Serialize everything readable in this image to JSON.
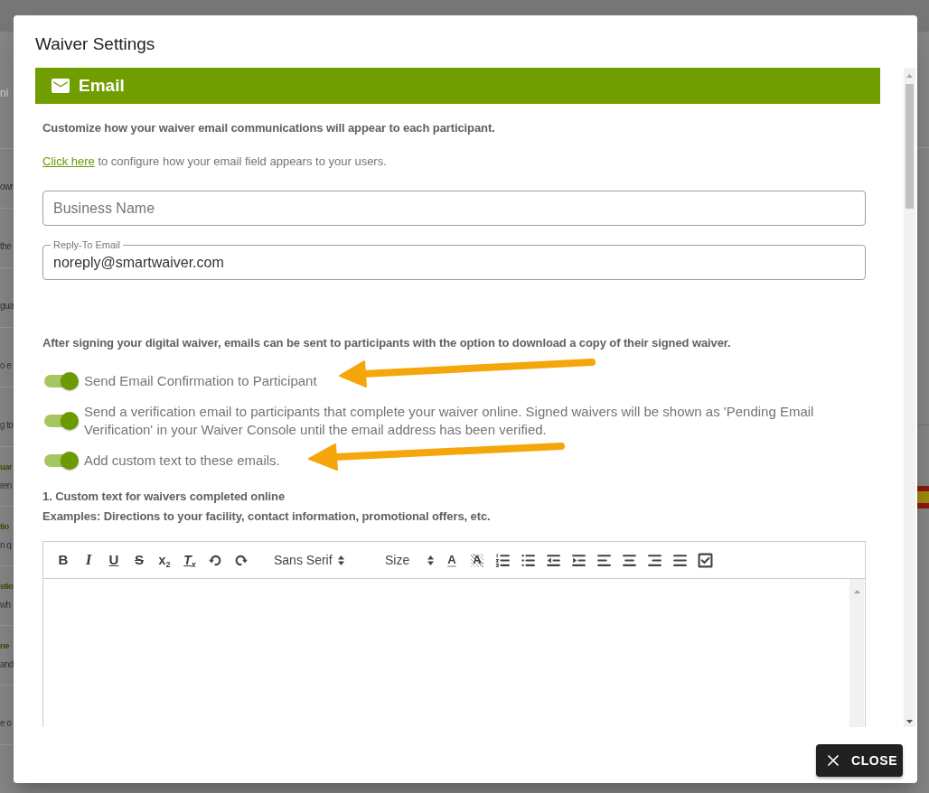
{
  "background_page": {
    "field_hint": "ni",
    "rows": [
      {
        "lines": [
          {
            "kind": "body",
            "text": "own"
          }
        ]
      },
      {
        "lines": [
          {
            "kind": "body",
            "text": "the"
          }
        ]
      },
      {
        "lines": [
          {
            "kind": "body",
            "text": "gua"
          }
        ]
      },
      {
        "lines": [
          {
            "kind": "body",
            "text": "o e"
          }
        ]
      },
      {
        "lines": [
          {
            "kind": "body",
            "text": "g to"
          }
        ]
      },
      {
        "lines": [
          {
            "kind": "heading",
            "text": "uar"
          },
          {
            "kind": "body",
            "text": "ren"
          }
        ]
      },
      {
        "lines": [
          {
            "kind": "heading",
            "text": "tio"
          },
          {
            "kind": "body",
            "text": "n q"
          }
        ]
      },
      {
        "lines": [
          {
            "kind": "heading",
            "text": "stio"
          },
          {
            "kind": "body",
            "text": "wh"
          }
        ]
      },
      {
        "lines": [
          {
            "kind": "heading",
            "text": "ne"
          },
          {
            "kind": "body",
            "text": "and"
          }
        ]
      },
      {
        "lines": [
          {
            "kind": "body",
            "text": "e o"
          }
        ]
      }
    ]
  },
  "dialog": {
    "title": "Waiver Settings",
    "section": {
      "title": "Email"
    },
    "intro": "Customize how your waiver email communications will appear to each participant.",
    "config_line": {
      "link": "Click here",
      "text": "to configure how your email field appears to your users."
    },
    "fields": [
      {
        "kind": "text",
        "placeholder": "Business Name"
      },
      {
        "kind": "text",
        "label": "Reply-To Email",
        "value": "noreply@smartwaiver.com"
      }
    ],
    "notice": "After signing your digital waiver, emails can be sent to participants with the option to download a copy of their signed waiver.",
    "toggles": [
      {
        "label": "Send Email Confirmation to Participant",
        "on": true
      },
      {
        "label": "Send a verification email to participants that complete your waiver online. Signed waivers will be shown as 'Pending Email Verification' in your Waiver Console until the email address has been verified.",
        "on": true
      },
      {
        "label": "Add custom text to these emails.",
        "on": true
      }
    ],
    "custom_text": {
      "heading": "1. Custom text for waivers completed online",
      "examples": "Examples: Directions to your facility, contact information, promotional offers, etc.",
      "toolbar": [
        {
          "kind": "bold",
          "label": "B"
        },
        {
          "kind": "italic",
          "label": "I"
        },
        {
          "kind": "underline",
          "label": "U"
        },
        {
          "kind": "strike",
          "label": "S"
        },
        {
          "kind": "script",
          "label": "x$_{2}$"
        },
        {
          "kind": "clean",
          "label": "T$_{x}$"
        },
        {
          "kind": "undo"
        },
        {
          "kind": "redo"
        },
        {
          "kind": "font",
          "label": "Sans Serif"
        },
        {
          "kind": "size",
          "label": "Size"
        },
        {
          "kind": "color",
          "label": "A"
        },
        {
          "kind": "background",
          "label": "A"
        },
        {
          "kind": "ordered"
        },
        {
          "kind": "bullet"
        },
        {
          "kind": "outdent"
        },
        {
          "kind": "indent"
        },
        {
          "kind": "left"
        },
        {
          "kind": "center"
        },
        {
          "kind": "right"
        },
        {
          "kind": "justify"
        },
        {
          "kind": "check"
        }
      ]
    },
    "close_button": {
      "label": "CLOSE"
    }
  }
}
